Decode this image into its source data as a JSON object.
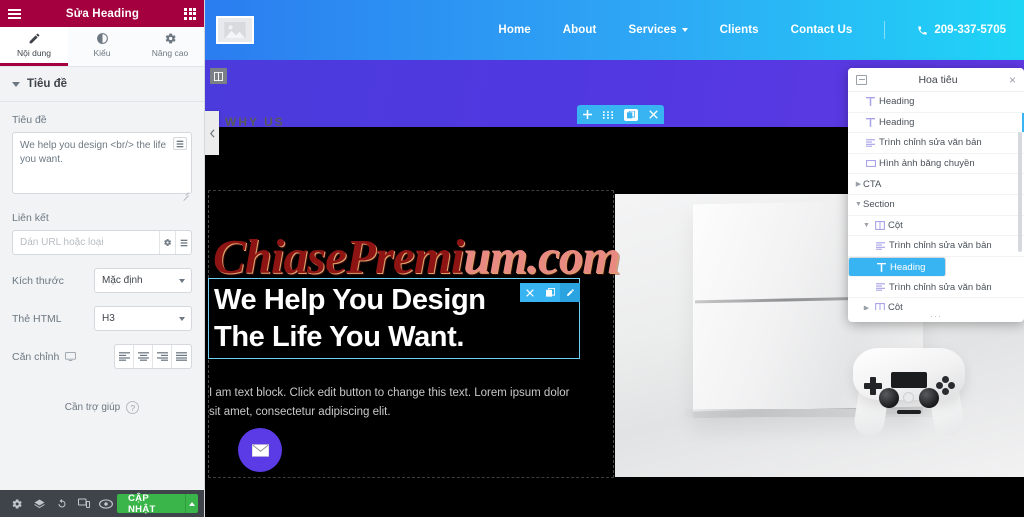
{
  "panel": {
    "title": "Sửa Heading",
    "menu_icon": "hamburger-icon",
    "apps_icon": "grid-icon",
    "tabs": [
      {
        "label": "Nội dung",
        "icon": "pencil-icon",
        "active": true
      },
      {
        "label": "Kiểu",
        "icon": "contrast-icon",
        "active": false
      },
      {
        "label": "Nâng cao",
        "icon": "gear-icon",
        "active": false
      }
    ],
    "section_title": "Tiêu đề",
    "fields": {
      "title_label": "Tiêu đề",
      "title_value": "We help you design <br/> the life you want.",
      "link_label": "Liên kết",
      "link_placeholder": "Dán URL hoặc loại",
      "size_label": "Kích thước",
      "size_value": "Mặc định",
      "html_tag_label": "Thẻ HTML",
      "html_tag_value": "H3",
      "align_label": "Căn chỉnh",
      "align_options": [
        "align-left",
        "align-center",
        "align-right",
        "align-justify"
      ]
    },
    "help_text": "Cần trợ giúp",
    "footer": {
      "icons": [
        "settings-icon",
        "layers-icon",
        "history-icon",
        "responsive-mode-icon",
        "preview-icon"
      ],
      "update_label": "CẬP NHẬT"
    }
  },
  "navigator": {
    "title": "Hoa tiêu",
    "dock_icon": "dock-icon",
    "close_icon": "close-icon",
    "items": [
      {
        "label": "Heading",
        "icon": "heading-icon",
        "indent": 3,
        "selected": false,
        "expandable": false
      },
      {
        "label": "Heading",
        "icon": "heading-icon",
        "indent": 3,
        "selected": false,
        "expandable": false,
        "marked": true
      },
      {
        "label": "Trình chỉnh sửa văn bản",
        "icon": "text-editor-icon",
        "indent": 3,
        "selected": false,
        "expandable": false
      },
      {
        "label": "Hình ảnh băng chuyền",
        "icon": "carousel-icon",
        "indent": 3,
        "selected": false,
        "expandable": false
      },
      {
        "label": "CTA",
        "icon": "none",
        "indent": 1,
        "selected": false,
        "expandable": true,
        "expanded": false
      },
      {
        "label": "Section",
        "icon": "none",
        "indent": 1,
        "selected": false,
        "expandable": true,
        "expanded": true
      },
      {
        "label": "Cột",
        "icon": "column-icon",
        "indent": 2,
        "selected": false,
        "expandable": true,
        "expanded": true
      },
      {
        "label": "Trình chỉnh sửa văn bản",
        "icon": "text-editor-icon",
        "indent": 4,
        "selected": false,
        "expandable": false
      },
      {
        "label": "Heading",
        "icon": "heading-icon",
        "indent": 4,
        "selected": true,
        "expandable": false
      },
      {
        "label": "Trình chỉnh sửa văn bản",
        "icon": "text-editor-icon",
        "indent": 4,
        "selected": false,
        "expandable": false
      },
      {
        "label": "Cột",
        "icon": "column-icon",
        "indent": 2,
        "selected": false,
        "expandable": true,
        "expanded": false
      }
    ],
    "resize_handle": "···"
  },
  "site": {
    "nav": [
      {
        "label": "Home",
        "has_caret": false
      },
      {
        "label": "About",
        "has_caret": false
      },
      {
        "label": "Services",
        "has_caret": true
      },
      {
        "label": "Clients",
        "has_caret": false
      },
      {
        "label": "Contact Us",
        "has_caret": false
      }
    ],
    "phone": "209-337-5705",
    "phone_icon": "phone-icon",
    "logo_icon": "image-placeholder-icon",
    "eyebrow": "WHY US",
    "heading_line1": "We Help You Design",
    "heading_line2": "The Life You Want.",
    "body_text": "I am text block. Click edit button to change this text. Lorem ipsum dolor sit amet, consectetur adipiscing elit.",
    "mail_icon": "envelope-icon"
  },
  "watermark": {
    "text_dark": "ChiasePremi",
    "text_light": "um.com"
  },
  "section_toolbar": {
    "icons": [
      "add-section-icon",
      "drag-handle-icon",
      "duplicate-icon",
      "delete-icon"
    ]
  },
  "element_toolbar": {
    "icons": [
      "delete-icon",
      "duplicate-icon",
      "edit-icon"
    ]
  },
  "canvas_handles": {
    "column_handle_icon": "column-handle-icon",
    "collapse_tab_icon": "chevron-left-icon"
  }
}
